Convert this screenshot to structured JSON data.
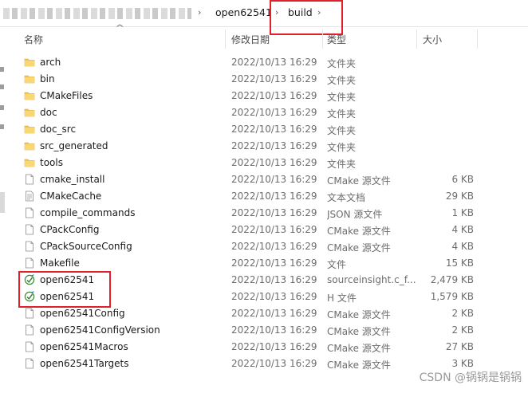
{
  "breadcrumb": {
    "items": [
      "open62541",
      "build"
    ],
    "separator": "›"
  },
  "columns": {
    "name": "名称",
    "date": "修改日期",
    "type": "类型",
    "size": "大小"
  },
  "files": [
    {
      "name": "arch",
      "date": "2022/10/13 16:29",
      "type": "文件夹",
      "size": "",
      "icon": "folder-icon"
    },
    {
      "name": "bin",
      "date": "2022/10/13 16:29",
      "type": "文件夹",
      "size": "",
      "icon": "folder-icon"
    },
    {
      "name": "CMakeFiles",
      "date": "2022/10/13 16:29",
      "type": "文件夹",
      "size": "",
      "icon": "folder-icon"
    },
    {
      "name": "doc",
      "date": "2022/10/13 16:29",
      "type": "文件夹",
      "size": "",
      "icon": "folder-icon"
    },
    {
      "name": "doc_src",
      "date": "2022/10/13 16:29",
      "type": "文件夹",
      "size": "",
      "icon": "folder-icon"
    },
    {
      "name": "src_generated",
      "date": "2022/10/13 16:29",
      "type": "文件夹",
      "size": "",
      "icon": "folder-icon"
    },
    {
      "name": "tools",
      "date": "2022/10/13 16:29",
      "type": "文件夹",
      "size": "",
      "icon": "folder-icon"
    },
    {
      "name": "cmake_install",
      "date": "2022/10/13 16:29",
      "type": "CMake 源文件",
      "size": "6 KB",
      "icon": "file-icon"
    },
    {
      "name": "CMakeCache",
      "date": "2022/10/13 16:29",
      "type": "文本文档",
      "size": "29 KB",
      "icon": "text-file-icon"
    },
    {
      "name": "compile_commands",
      "date": "2022/10/13 16:29",
      "type": "JSON 源文件",
      "size": "1 KB",
      "icon": "file-icon"
    },
    {
      "name": "CPackConfig",
      "date": "2022/10/13 16:29",
      "type": "CMake 源文件",
      "size": "4 KB",
      "icon": "file-icon"
    },
    {
      "name": "CPackSourceConfig",
      "date": "2022/10/13 16:29",
      "type": "CMake 源文件",
      "size": "4 KB",
      "icon": "file-icon"
    },
    {
      "name": "Makefile",
      "date": "2022/10/13 16:29",
      "type": "文件",
      "size": "15 KB",
      "icon": "file-icon"
    },
    {
      "name": "open62541",
      "date": "2022/10/13 16:29",
      "type": "sourceinsight.c_f...",
      "size": "2,479 KB",
      "icon": "sourceinsight-file-icon"
    },
    {
      "name": "open62541",
      "date": "2022/10/13 16:29",
      "type": "H 文件",
      "size": "1,579 KB",
      "icon": "sourceinsight-file-icon"
    },
    {
      "name": "open62541Config",
      "date": "2022/10/13 16:29",
      "type": "CMake 源文件",
      "size": "2 KB",
      "icon": "file-icon"
    },
    {
      "name": "open62541ConfigVersion",
      "date": "2022/10/13 16:29",
      "type": "CMake 源文件",
      "size": "2 KB",
      "icon": "file-icon"
    },
    {
      "name": "open62541Macros",
      "date": "2022/10/13 16:29",
      "type": "CMake 源文件",
      "size": "27 KB",
      "icon": "file-icon"
    },
    {
      "name": "open62541Targets",
      "date": "2022/10/13 16:29",
      "type": "CMake 源文件",
      "size": "3 KB",
      "icon": "file-icon"
    }
  ],
  "watermark": "CSDN @锅锅是锅锅",
  "colors": {
    "folder": "#f3c450",
    "highlight_border": "#e0202a",
    "sourceinsight_icon": "#3a8a3a"
  }
}
